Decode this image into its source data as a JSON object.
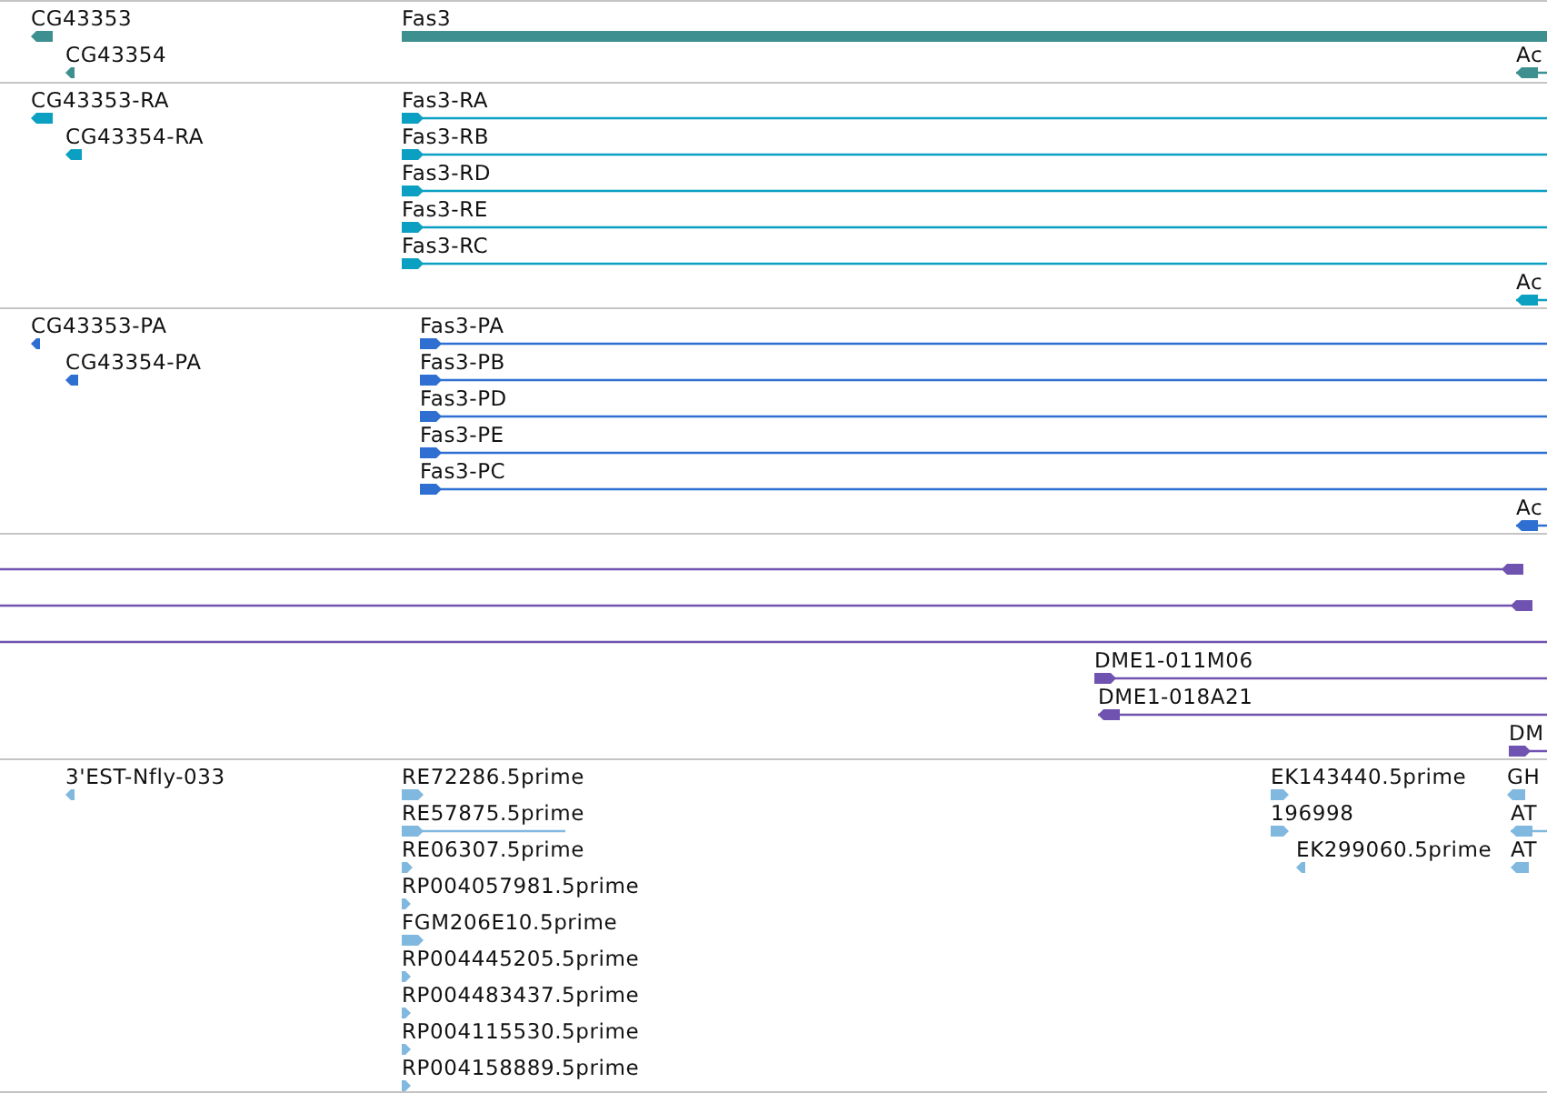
{
  "tracks": [
    {
      "kind": "gene",
      "color": "#3e8f90",
      "features": [
        {
          "label": "CG43353",
          "reverse": true
        },
        {
          "label": "CG43354",
          "reverse": true
        },
        {
          "label": "Fas3"
        },
        {
          "label": "Ac",
          "reverse": true
        }
      ]
    },
    {
      "kind": "transcript",
      "color": "#0ba0c2",
      "features": [
        {
          "label": "CG43353-RA",
          "reverse": true
        },
        {
          "label": "CG43354-RA",
          "reverse": true
        },
        {
          "label": "Fas3-RA",
          "reverse": false
        },
        {
          "label": "Fas3-RB",
          "reverse": false
        },
        {
          "label": "Fas3-RD",
          "reverse": false
        },
        {
          "label": "Fas3-RE",
          "reverse": false
        },
        {
          "label": "Fas3-RC",
          "reverse": false
        },
        {
          "label": "Ac",
          "reverse": true
        }
      ]
    },
    {
      "kind": "protein",
      "color": "#2f6fd2",
      "features": [
        {
          "label": "CG43353-PA",
          "reverse": true
        },
        {
          "label": "CG43354-PA",
          "reverse": true
        },
        {
          "label": "Fas3-PA",
          "reverse": false
        },
        {
          "label": "Fas3-PB",
          "reverse": false
        },
        {
          "label": "Fas3-PD",
          "reverse": false
        },
        {
          "label": "Fas3-PE",
          "reverse": false
        },
        {
          "label": "Fas3-PC",
          "reverse": false
        },
        {
          "label": "Ac",
          "reverse": true
        }
      ]
    },
    {
      "kind": "alignment",
      "color": "#7052b0",
      "features": [
        {
          "kind": "feature",
          "reverse": true
        },
        {
          "kind": "feature",
          "reverse": true
        },
        {
          "kind": "line"
        },
        {
          "kind": "feature",
          "label": "DME1-011M06",
          "reverse": false
        },
        {
          "kind": "feature",
          "label": "DME1-018A21",
          "reverse": true
        },
        {
          "kind": "feature",
          "label": "DM",
          "reverse": false
        }
      ]
    },
    {
      "kind": "est",
      "color": "#80b8e0",
      "features": [
        {
          "label": "3'EST-Nfly-033",
          "reverse": true
        },
        {
          "label": "RE72286.5prime",
          "reverse": false
        },
        {
          "label": "RE57875.5prime",
          "reverse": false
        },
        {
          "label": "RE06307.5prime",
          "reverse": false
        },
        {
          "label": "RP004057981.5prime",
          "reverse": false
        },
        {
          "label": "FGM206E10.5prime",
          "reverse": false
        },
        {
          "label": "RP004445205.5prime",
          "reverse": false
        },
        {
          "label": "RP004483437.5prime",
          "reverse": false
        },
        {
          "label": "RP004115530.5prime",
          "reverse": false
        },
        {
          "label": "RP004158889.5prime",
          "reverse": false
        },
        {
          "label": "EK143440.5prime",
          "reverse": false
        },
        {
          "label": "196998",
          "reverse": false
        },
        {
          "label": "EK299060.5prime",
          "reverse": true
        },
        {
          "label": "GH",
          "reverse": true
        },
        {
          "label": "AT",
          "reverse": true
        },
        {
          "label": "AT",
          "reverse": true
        }
      ]
    }
  ]
}
